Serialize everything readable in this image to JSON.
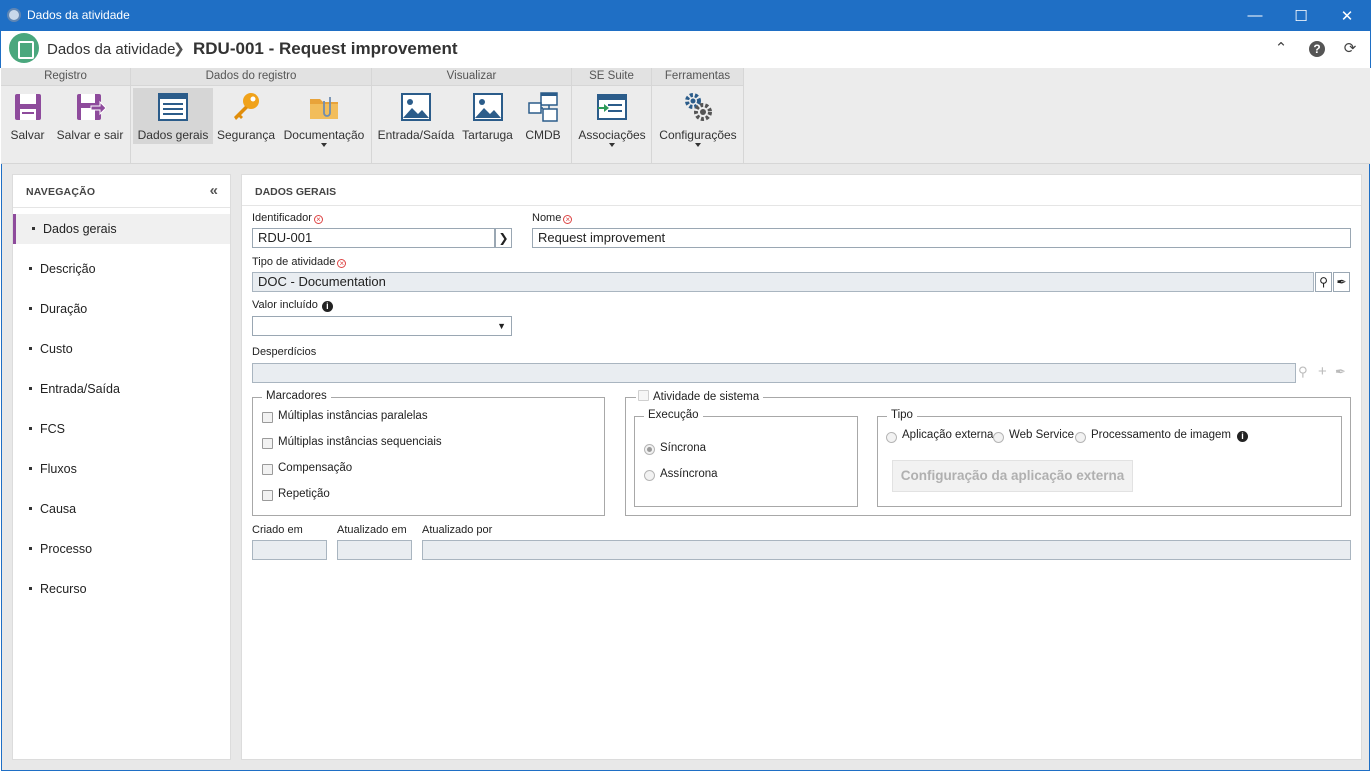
{
  "window": {
    "title": "Dados da atividade"
  },
  "header": {
    "breadcrumb_root": "Dados da atividade",
    "breadcrumb_current": "RDU-001 - Request improvement"
  },
  "toolbar": {
    "groups": {
      "registro": "Registro",
      "dados_registro": "Dados do registro",
      "visualizar": "Visualizar",
      "se_suite": "SE Suite",
      "ferramentas": "Ferramentas"
    },
    "buttons": {
      "salvar": "Salvar",
      "salvar_sair": "Salvar e sair",
      "dados_gerais": "Dados gerais",
      "seguranca": "Segurança",
      "documentacao": "Documentação",
      "entrada_saida": "Entrada/Saída",
      "tartaruga": "Tartaruga",
      "cmdb": "CMDB",
      "associacoes": "Associações",
      "configuracoes": "Configurações"
    }
  },
  "nav": {
    "title": "NAVEGAÇÃO",
    "items": [
      "Dados gerais",
      "Descrição",
      "Duração",
      "Custo",
      "Entrada/Saída",
      "FCS",
      "Fluxos",
      "Causa",
      "Processo",
      "Recurso"
    ]
  },
  "main": {
    "title": "DADOS GERAIS",
    "identificador": {
      "label": "Identificador",
      "value": "RDU-001"
    },
    "nome": {
      "label": "Nome",
      "value": "Request improvement"
    },
    "tipo_atividade": {
      "label": "Tipo de atividade",
      "value": "DOC - Documentation"
    },
    "valor_incluido": {
      "label": "Valor incluído",
      "value": ""
    },
    "desperdicios": {
      "label": "Desperdícios",
      "value": ""
    },
    "marcadores": {
      "legend": "Marcadores",
      "options": [
        "Múltiplas instâncias paralelas",
        "Múltiplas instâncias sequenciais",
        "Compensação",
        "Repetição"
      ]
    },
    "atividade_sistema": {
      "legend": "Atividade de sistema",
      "execucao": {
        "legend": "Execução",
        "options": [
          "Síncrona",
          "Assíncrona"
        ],
        "selected": "Síncrona"
      },
      "tipo": {
        "legend": "Tipo",
        "options": [
          "Aplicação externa",
          "Web Service",
          "Processamento de imagem"
        ]
      },
      "config_button": "Configuração da aplicação externa"
    },
    "criado_em": {
      "label": "Criado em",
      "value": ""
    },
    "atualizado_em": {
      "label": "Atualizado em",
      "value": ""
    },
    "atualizado_por": {
      "label": "Atualizado por",
      "value": ""
    }
  }
}
